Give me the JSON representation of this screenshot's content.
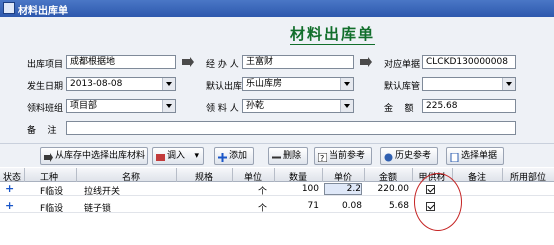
{
  "window": {
    "title": "材料出库单"
  },
  "form": {
    "heading": "材料出库单",
    "fields": {
      "project": {
        "label": "出库项目",
        "value": "成都根据地"
      },
      "handler": {
        "label": "经 办 人",
        "value": "王富财"
      },
      "voucher": {
        "label": "对应单据",
        "value": "CLCKD130000008"
      },
      "date": {
        "label": "发生日期",
        "value": "2013-08-08"
      },
      "warehouse": {
        "label": "默认出库",
        "value": "乐山库房"
      },
      "default_store": {
        "label": "默认库管",
        "value": ""
      },
      "team": {
        "label": "领料班组",
        "value": "项目部"
      },
      "receiver": {
        "label": "领 料 人",
        "value": "孙乾"
      },
      "amount": {
        "label": "金    额",
        "value": "225.68"
      },
      "remark": {
        "label": "备    注",
        "value": ""
      }
    }
  },
  "toolbar": {
    "select_from_stock": "从库存中选择出库材料",
    "import": "调入",
    "add": "添加",
    "delete": "删除",
    "current_ref": "当前参考",
    "history_ref": "历史参考",
    "select_voucher": "选择单据"
  },
  "table": {
    "headers": [
      "状态",
      "工种",
      "名称",
      "规格",
      "单位",
      "数量",
      "单价",
      "金额",
      "甲供材",
      "备注",
      "所用部位"
    ],
    "rows": [
      {
        "status": "+",
        "trade": "F临设",
        "name": "拉线开关",
        "spec": "",
        "unit": "个",
        "qty": "100",
        "price": "2.2",
        "amount": "220.00",
        "owner_supplied": true,
        "remark": "",
        "location": ""
      },
      {
        "status": "+",
        "trade": "F临设",
        "name": "链子锁",
        "spec": "",
        "unit": "个",
        "qty": "71",
        "price": "0.08",
        "amount": "5.68",
        "owner_supplied": true,
        "remark": "",
        "location": ""
      }
    ]
  },
  "colors": {
    "title_bar": "#2d58ad",
    "heading": "#116e2b",
    "highlight_circle": "#c52424"
  }
}
